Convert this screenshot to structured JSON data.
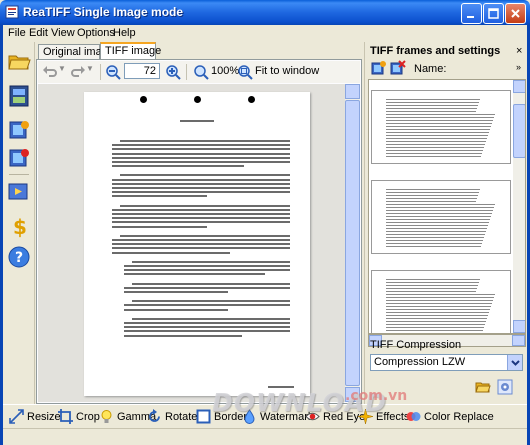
{
  "window": {
    "title": "ReaTIFF Single Image mode",
    "title_icon": "tiff-app-icon",
    "minimize_icon": "minimize-icon",
    "maximize_icon": "maximize-icon",
    "close_icon": "close-icon"
  },
  "menu": [
    "File",
    "Edit",
    "View",
    "Options",
    "Help"
  ],
  "leftbar": {
    "icons": [
      "open-folder-icon",
      "film-frames-icon",
      "add-image-icon",
      "remove-image-icon",
      "slideshow-icon",
      "dollar-icon",
      "help-icon"
    ]
  },
  "tabs": [
    {
      "label": "Original image",
      "active": false
    },
    {
      "label": "TIFF image",
      "active": true
    }
  ],
  "toolbar": {
    "undo_icon": "undo-icon",
    "redo_icon": "redo-icon",
    "zoom_out_icon": "zoom-out-icon",
    "zoom_value": "72",
    "zoom_in_icon": "zoom-in-icon",
    "zoom_100_label": "100%",
    "fit_label": "Fit to window"
  },
  "right_panel": {
    "title": "TIFF frames and settings",
    "close_glyph": "×",
    "name_label": "Name:",
    "chevron": "»",
    "compression_label": "TIFF Compression",
    "compression_value": "Compression LZW"
  },
  "bottom_tools": [
    {
      "label": "Resize",
      "icon": "resize-icon"
    },
    {
      "label": "Crop",
      "icon": "crop-icon"
    },
    {
      "label": "Gamma",
      "icon": "gamma-icon"
    },
    {
      "label": "Rotate",
      "icon": "rotate-icon"
    },
    {
      "label": "Border",
      "icon": "border-icon"
    },
    {
      "label": "Watermark",
      "icon": "watermark-icon"
    },
    {
      "label": "Red Eye",
      "icon": "red-eye-icon"
    },
    {
      "label": "Effects",
      "icon": "effects-icon"
    },
    {
      "label": "Color Replace",
      "icon": "color-replace-icon"
    }
  ],
  "watermark": {
    "text": "DOWNLOAD",
    "suffix": ".com.vn"
  },
  "colors": {
    "accent": "#0a5fd8",
    "tab_highlight": "#f5a623"
  }
}
